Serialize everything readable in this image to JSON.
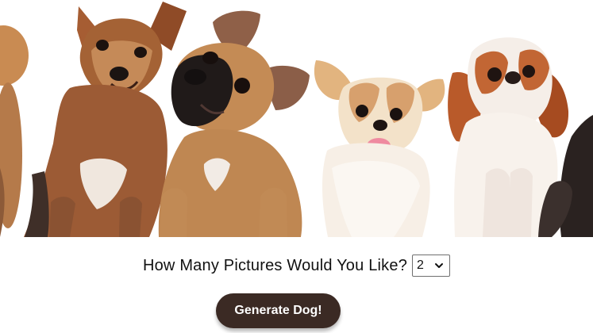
{
  "hero": {
    "image_name": "row of dogs photo",
    "colors": {
      "background": "#ffffff",
      "terrier_brown": "#9a5f35",
      "bulldog_tan": "#c28a56",
      "bulldog_mask": "#231c1a",
      "chihuahua_cream": "#f3dfc3",
      "chihuahua_brown": "#d9a46d",
      "spaniel_red": "#b75a2b",
      "spaniel_white": "#f7f0e8",
      "dark_fur": "#2a2220"
    }
  },
  "form": {
    "prompt": "How Many Pictures Would You Like?",
    "selected_count": "2",
    "dropdown_icon": "chevron-down-icon"
  },
  "actions": {
    "generate_label": "Generate Dog!",
    "button_color": "#3b2a24"
  }
}
